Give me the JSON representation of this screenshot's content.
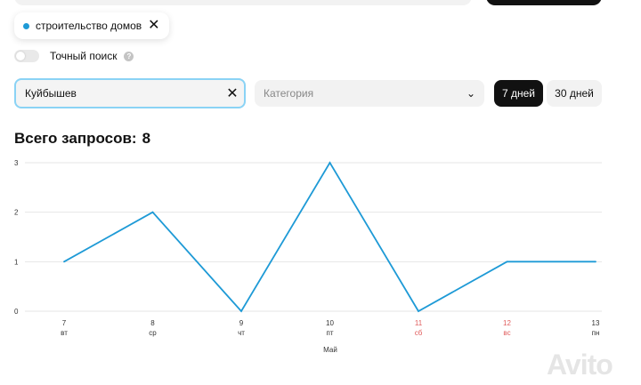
{
  "chip": {
    "label": "строительство домов"
  },
  "exact_search": {
    "label": "Точный поиск",
    "help": "?"
  },
  "search": {
    "value": "Куйбышев"
  },
  "category": {
    "placeholder": "Категория"
  },
  "periods": [
    {
      "label": "7 дней"
    },
    {
      "label": "30 дней"
    }
  ],
  "total": {
    "label": "Всего запросов:",
    "value": "8"
  },
  "colors": {
    "line": "#1e9ad6",
    "weekend": "#e05c5c",
    "accent": "#8ad3f5"
  },
  "chart_data": {
    "type": "line",
    "x": [
      "7",
      "8",
      "9",
      "10",
      "11",
      "12",
      "13"
    ],
    "weekdays": [
      "вт",
      "ср",
      "чт",
      "пт",
      "сб",
      "вс",
      "пн"
    ],
    "weekend": [
      false,
      false,
      false,
      false,
      true,
      true,
      false
    ],
    "series": [
      {
        "values": [
          1,
          2,
          0,
          3,
          0,
          1,
          1
        ]
      }
    ],
    "y_ticks": [
      0,
      1,
      2,
      3
    ],
    "ylim": [
      0,
      3
    ],
    "xlabel": "Май",
    "grid": true
  },
  "watermark": {
    "text": "Avito"
  }
}
